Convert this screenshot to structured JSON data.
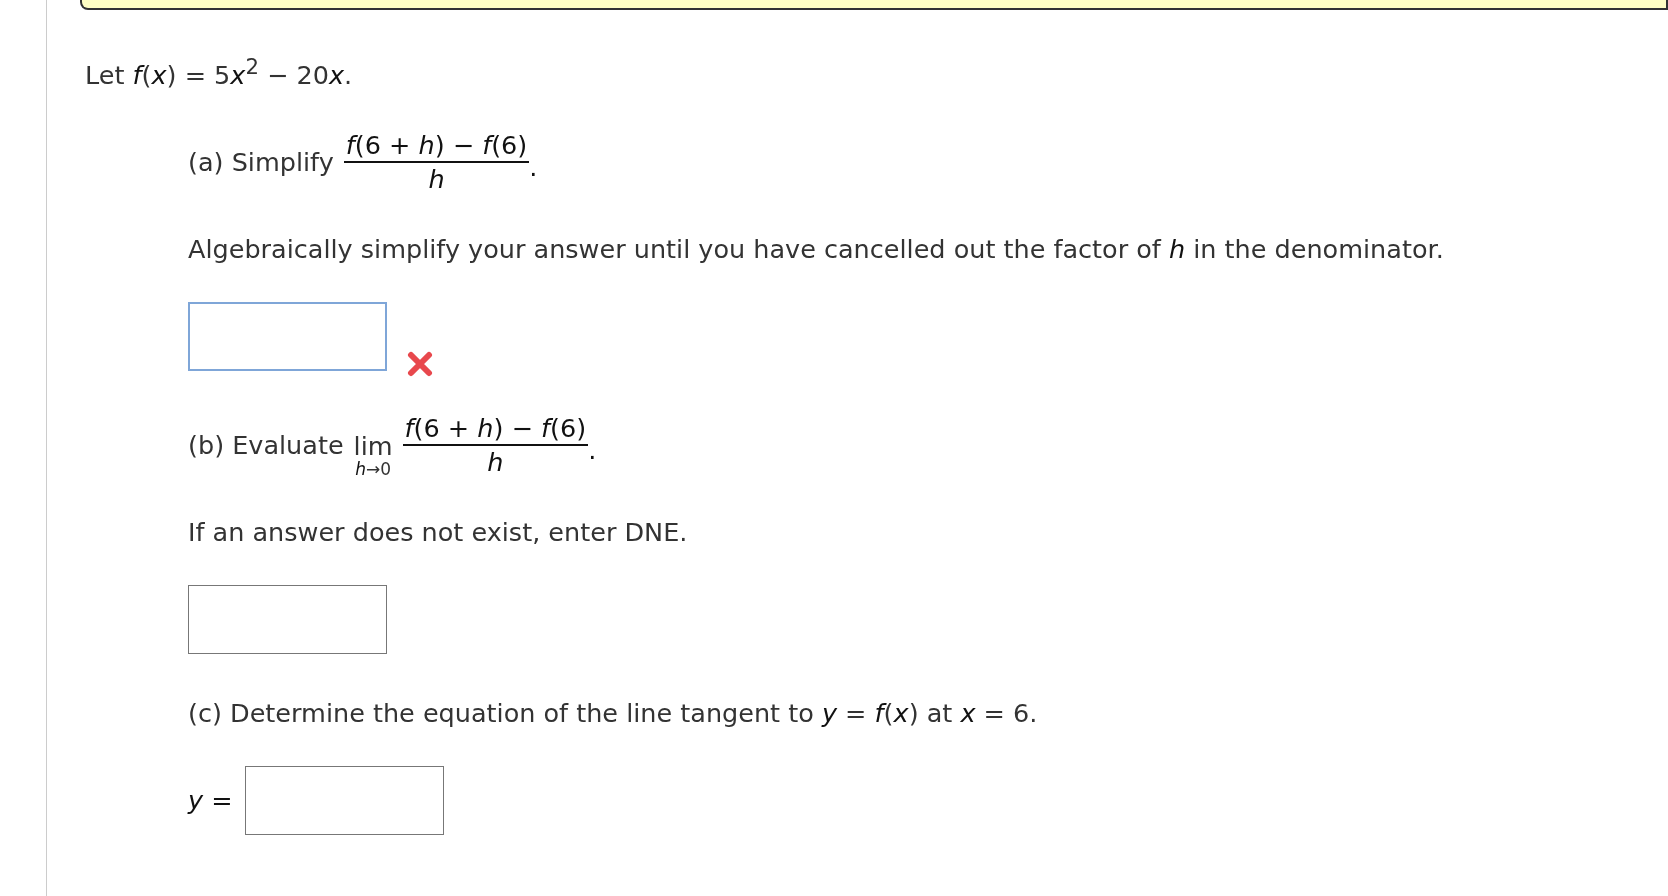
{
  "banner": {
    "shown": true
  },
  "function_definition": [
    "Let *f*(*x*) = 5",
    "*x*$^{2}$ − 20",
    "*x*."
  ],
  "parts": [
    {
      "kind": "fraction",
      "label": "(a) Simplify",
      "numerator": "*f*(6 + *h*) − *f*(6)",
      "denominator": "*h*",
      "trailing": ".",
      "instruction": "Algebraically simplify your answer until you have cancelled out the factor of *h* in the denominator.",
      "answer": {
        "focused": true,
        "incorrect": true
      }
    },
    {
      "kind": "limit",
      "label": "(b) Evaluate",
      "limit": "lim",
      "limit_under": "*h*→0",
      "numerator": "*f*(6 + *h*) − *f*(6)",
      "denominator": "*h*",
      "trailing": ".",
      "instruction": "If an answer does not exist, enter DNE.",
      "answer": {
        "focused": false,
        "incorrect": false
      }
    },
    {
      "kind": "plain",
      "label": "(c) Determine the equation of the line tangent to *y* = *f*(*x*) at *x* = 6.",
      "answer": {
        "prefix": "*y* =",
        "focused": false,
        "incorrect": false
      }
    }
  ]
}
